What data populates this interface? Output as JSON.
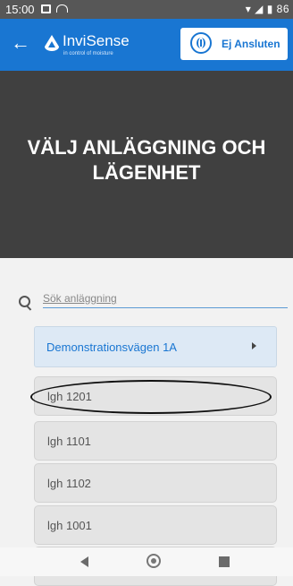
{
  "status_bar": {
    "time": "15:00",
    "battery_text": "86"
  },
  "app_bar": {
    "brand": "InviSense",
    "brand_sub": "in control of moisture",
    "connection_label": "Ej Ansluten"
  },
  "hero": {
    "title": "VÄLJ ANLÄGGNING OCH LÄGENHET"
  },
  "search": {
    "placeholder": "Sök anläggning"
  },
  "facility": {
    "label": "Demonstrationsvägen 1A"
  },
  "apartments": [
    {
      "label": "lgh 1201"
    },
    {
      "label": "lgh 1101"
    },
    {
      "label": "lgh 1102"
    },
    {
      "label": "lgh 1001"
    }
  ],
  "colors": {
    "accent": "#1976d2",
    "hero_bg": "#404040",
    "status_bar_bg": "#575757"
  }
}
